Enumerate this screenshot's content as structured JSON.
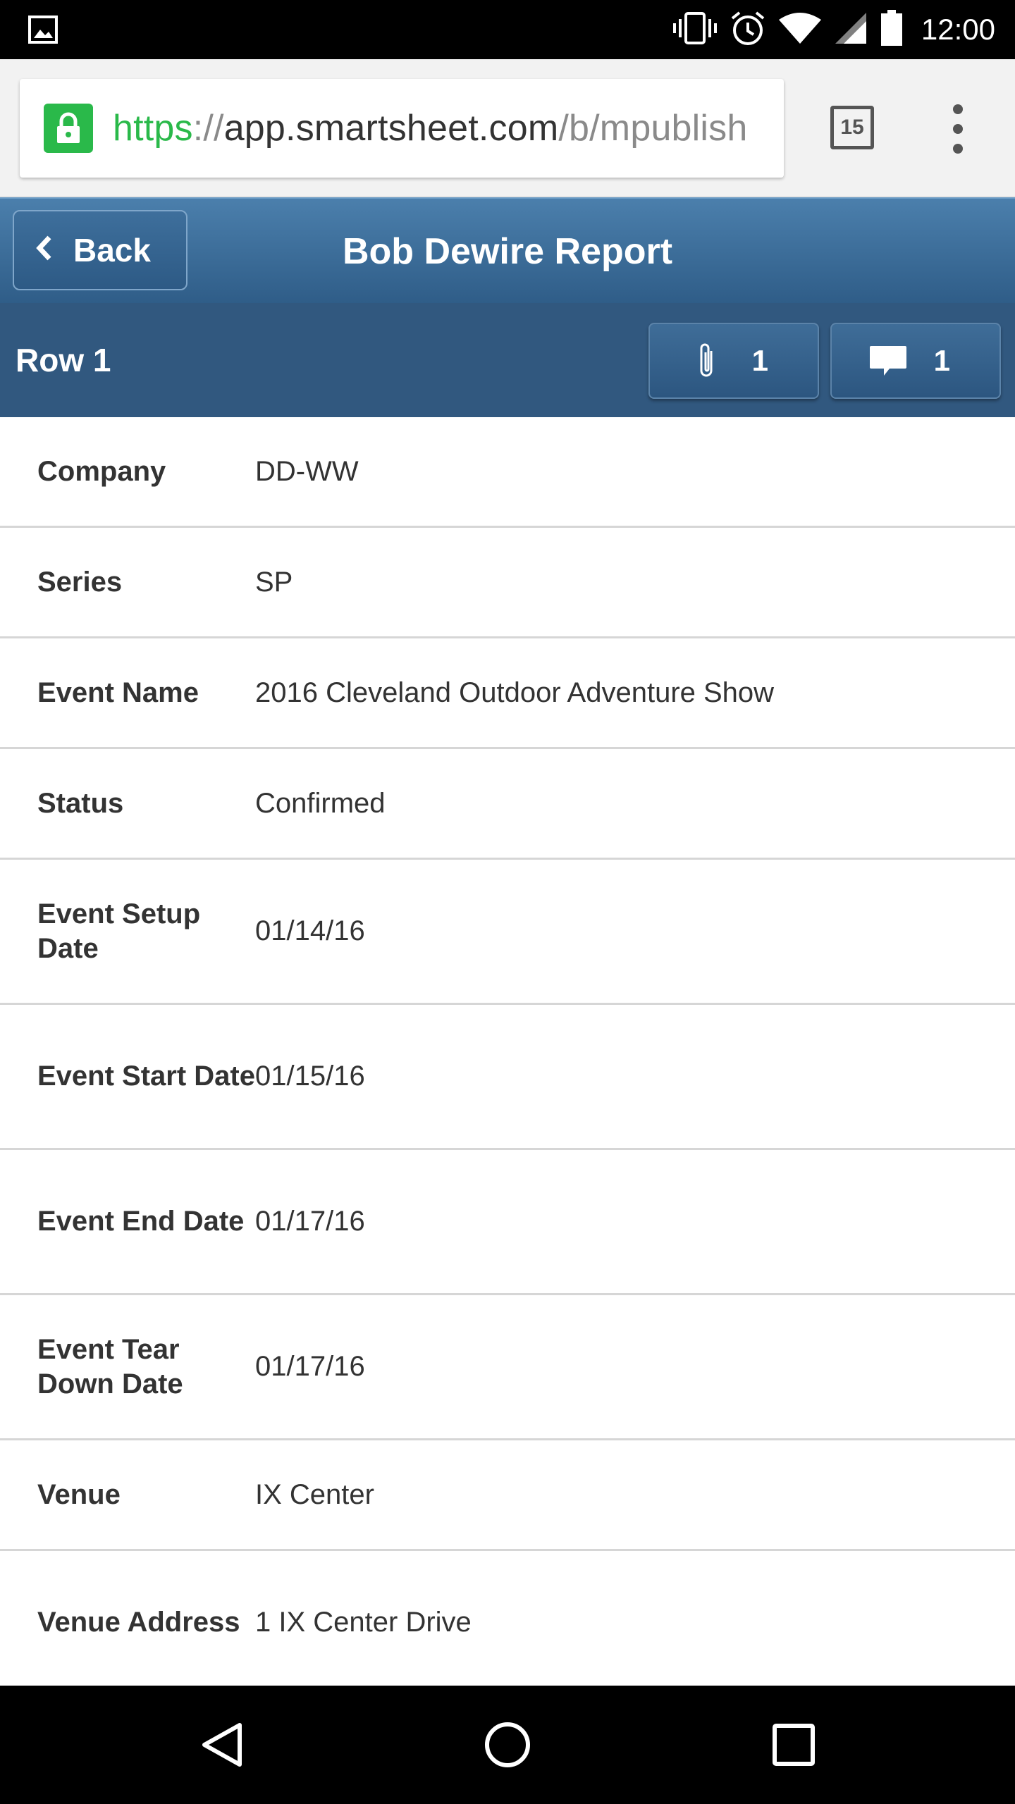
{
  "status_bar": {
    "time": "12:00",
    "icons": [
      "image-notification-icon",
      "vibrate-icon",
      "alarm-icon",
      "wifi-icon",
      "signal-icon",
      "battery-icon"
    ]
  },
  "browser": {
    "url_scheme": "https",
    "url_sep": "://",
    "url_host": "app.smartsheet.com",
    "url_path": "/b/mpublish",
    "tab_count": "15"
  },
  "header": {
    "back_label": "Back",
    "title": "Bob Dewire Report"
  },
  "row_bar": {
    "row_label": "Row 1",
    "attachments_count": "1",
    "comments_count": "1"
  },
  "fields": [
    {
      "label": "Company",
      "value": "DD-WW"
    },
    {
      "label": "Series",
      "value": "SP"
    },
    {
      "label": "Event Name",
      "value": "2016 Cleveland Outdoor Adventure Show"
    },
    {
      "label": "Status",
      "value": "Confirmed"
    },
    {
      "label": "Event Setup Date",
      "value": "01/14/16"
    },
    {
      "label": "Event Start Date",
      "value": "01/15/16"
    },
    {
      "label": "Event End Date",
      "value": "01/17/16"
    },
    {
      "label": "Event Tear Down Date",
      "value": "01/17/16"
    },
    {
      "label": "Venue",
      "value": "IX Center"
    },
    {
      "label": "Venue Address",
      "value": "1 IX Center Drive"
    }
  ],
  "colors": {
    "header_blue": "#2f5d88",
    "row_bar_blue": "#31587f",
    "lock_green": "#2ab94a"
  }
}
